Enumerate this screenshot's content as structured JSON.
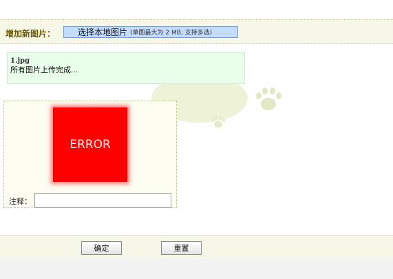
{
  "add_section": {
    "label": "增加新图片：",
    "pick_button_label": "选择本地图片",
    "pick_button_hint": "(单图最大为 2 MB, 支持多选)"
  },
  "upload_status": {
    "file_name": "1.jpg",
    "message": "所有图片上传完成..."
  },
  "image_card": {
    "image_text": "ERROR",
    "note_label": "注释：",
    "note_value": ""
  },
  "actions": {
    "confirm_label": "确定",
    "reset_label": "重置"
  },
  "colors": {
    "accent_blue": "#c4dcff",
    "error_red": "#ff0000",
    "status_green": "#eaffea"
  }
}
